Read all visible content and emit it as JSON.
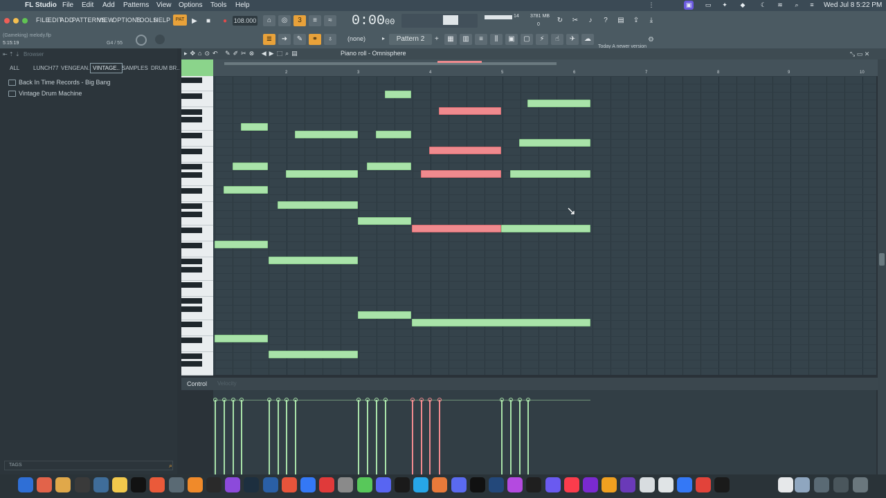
{
  "menubar": {
    "app": "FL Studio",
    "items": [
      "File",
      "Edit",
      "Add",
      "Patterns",
      "View",
      "Options",
      "Tools",
      "Help"
    ],
    "clock": "Wed Jul 8  5:22 PM"
  },
  "fl": {
    "menu": [
      "FILE",
      "EDIT",
      "ADD",
      "PATTERNS",
      "VIEW",
      "OPTIONS",
      "TOOLS",
      "HELP"
    ],
    "file_hint": "(Gameking) melody.flp",
    "position": "5:15:19",
    "note_hint": "G4 / 55",
    "tempo": "108.000",
    "time": "0:00",
    "time_sub": "00",
    "mem": "3781 MB",
    "cpu": "14",
    "voices": "0",
    "snap": "(none)",
    "pattern": "Pattern 2",
    "news_title": "Today",
    "news_text": "A newer version of FL Studio i..."
  },
  "browser": {
    "title": "Browser",
    "tabs": [
      "ALL",
      "LUNCH77",
      "VENGEAN..",
      "VINTAGE..",
      "SAMPLES",
      "DRUM BR.."
    ],
    "active_tab": "VINTAGE..",
    "items": [
      "Back In Time Records - Big Bang",
      "Vintage Drum Machine"
    ],
    "tags_label": "TAGS"
  },
  "pianoroll": {
    "title": "Piano roll - Omnisphere",
    "bars": [
      "2",
      "3",
      "4",
      "5",
      "6",
      "7",
      "8",
      "9",
      "10"
    ],
    "control_label": "Control",
    "control_sub": "Velocity"
  },
  "colors": {
    "note": "#a9e3a9",
    "selected_note": "#f08a8e",
    "accent": "#e9a23a"
  }
}
